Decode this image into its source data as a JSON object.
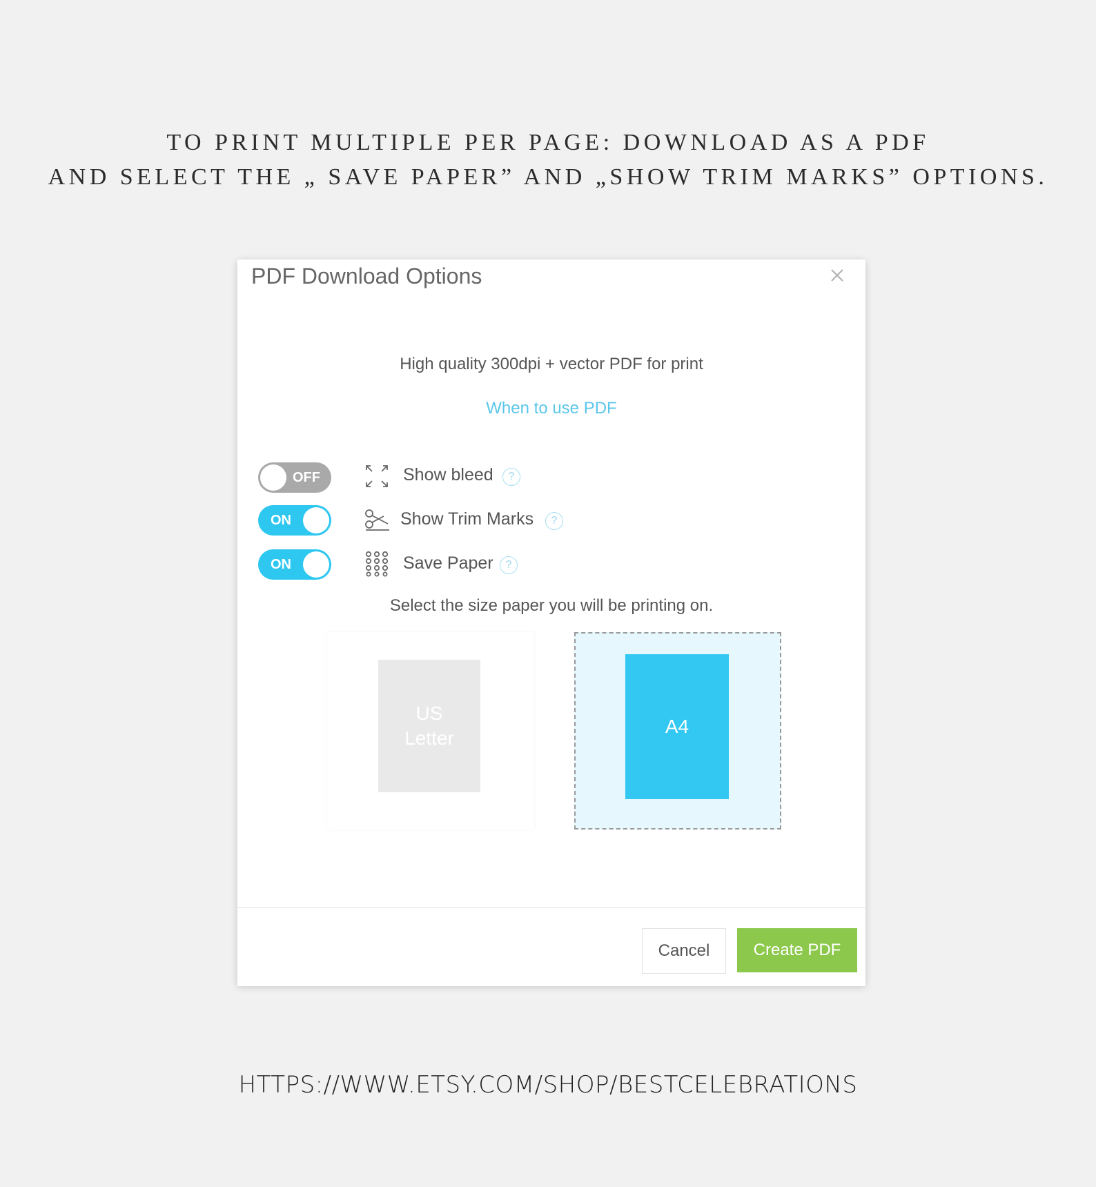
{
  "headline": {
    "line1": "TO PRINT MULTIPLE PER PAGE: DOWNLOAD AS A PDF",
    "line2": "AND SELECT THE „ SAVE PAPER” AND „SHOW TRIM MARKS” OPTIONS."
  },
  "dialog": {
    "title": "PDF Download Options",
    "description": "High quality 300dpi + vector PDF for print",
    "help_link": "When to use PDF",
    "options": [
      {
        "label": "Show bleed",
        "toggle": "OFF",
        "icon": "expand-arrows-icon"
      },
      {
        "label": "Show Trim Marks",
        "toggle": "ON",
        "icon": "scissors-icon"
      },
      {
        "label": "Save Paper",
        "toggle": "ON",
        "icon": "grid-dots-icon"
      }
    ],
    "help_icon": "question-icon",
    "size_prompt": "Select the size paper you will be printing on.",
    "paper_sizes": [
      {
        "label": "US Letter",
        "selected": false
      },
      {
        "label": "A4",
        "selected": true
      }
    ],
    "buttons": {
      "cancel": "Cancel",
      "create": "Create PDF"
    }
  },
  "footer_url": "HTTPS://WWW.ETSY.COM/SHOP/BESTCELEBRATIONS",
  "colors": {
    "background": "#f1f1f1",
    "toggle_on": "#2ec7f0",
    "toggle_off": "#a9a9a9",
    "link": "#5bc6ea",
    "selected_paper": "#33c8f2",
    "create_button": "#8cc84b"
  }
}
